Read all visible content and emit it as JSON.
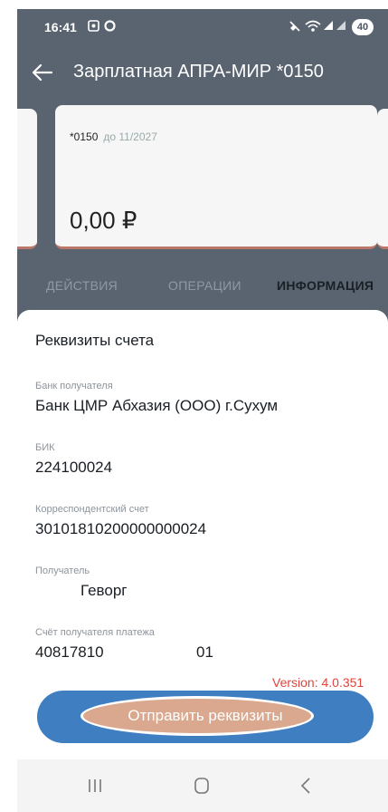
{
  "status_bar": {
    "time": "16:41",
    "battery": "40",
    "icons": [
      "screenshot-icon",
      "circle-icon",
      "mute-icon",
      "wifi-icon",
      "signal-icon",
      "signal-icon-2"
    ]
  },
  "header": {
    "title": "Зарплатная АПРА-МИР *0150"
  },
  "card": {
    "number": "*0150",
    "expiry": "до 11/2027",
    "balance": "0,00 ₽"
  },
  "tabs": [
    {
      "label": "ДЕЙСТВИЯ",
      "active": false
    },
    {
      "label": "ОПЕРАЦИИ",
      "active": false
    },
    {
      "label": "ИНФОРМАЦИЯ",
      "active": true
    }
  ],
  "details": {
    "title": "Реквизиты счета",
    "fields": [
      {
        "label": "Банк получателя",
        "value": "Банк ЦМР Абхазия (ООО) г.Сухум"
      },
      {
        "label": "БИК",
        "value": "224100024"
      },
      {
        "label": "Корреспондентский счет",
        "value": "30101810200000000024"
      },
      {
        "label": "Получатель",
        "value": "Геворг"
      },
      {
        "label": "Счёт получателя платежа",
        "value": "40817810",
        "value_suffix": "01"
      }
    ]
  },
  "version": "Version: 4.0.351",
  "send_button": {
    "label": "Отправить реквизиты"
  },
  "colors": {
    "header_bg": "#5a6470",
    "accent_button": "#3e7ec1",
    "card_stripe": "#b9776a",
    "version_text": "#e0453c"
  }
}
